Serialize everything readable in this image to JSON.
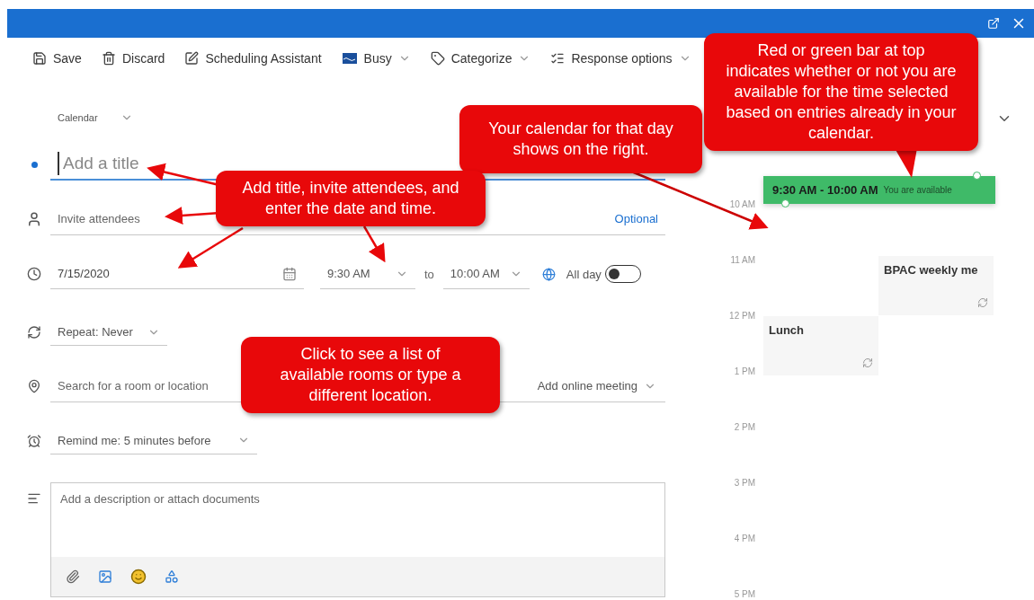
{
  "toolbar": [
    {
      "label": "Save",
      "dropdown": false
    },
    {
      "label": "Discard",
      "dropdown": false
    },
    {
      "label": "Scheduling Assistant",
      "dropdown": false
    },
    {
      "label": "Busy",
      "dropdown": true
    },
    {
      "label": "Categorize",
      "dropdown": true
    },
    {
      "label": "Response options",
      "dropdown": true
    }
  ],
  "form": {
    "calendar": "Calendar",
    "title_placeholder": "Add a title",
    "attendees_placeholder": "Invite attendees",
    "optional": "Optional",
    "date": "7/15/2020",
    "start_time": "9:30 AM",
    "to": "to",
    "end_time": "10:00 AM",
    "all_day": {
      "label": "All day",
      "on": false
    },
    "repeat": "Repeat: Never",
    "location_placeholder": "Search for a room or location",
    "online_meeting": "Add online meeting",
    "reminder": "Remind me: 5 minutes before",
    "description_placeholder": "Add a description or attach documents"
  },
  "day_view": {
    "hours": [
      "10 AM",
      "11 AM",
      "12 PM",
      "1 PM",
      "2 PM",
      "3 PM",
      "4 PM",
      "5 PM"
    ],
    "proposal": {
      "time": "9:30 AM - 10:00 AM",
      "status": "You are available",
      "available": true
    },
    "events": [
      {
        "title": "BPAC weekly me"
      },
      {
        "title": "Lunch"
      }
    ]
  },
  "callouts": [
    {
      "text": "Your calendar for that day shows on the right."
    },
    {
      "text": "Red or green bar at top indicates whether or not you are available for the time selected based on entries already in your calendar."
    },
    {
      "text": "Add title, invite attendees, and enter the date and time."
    },
    {
      "text": "Click to see a list of available rooms or type a different location."
    }
  ]
}
